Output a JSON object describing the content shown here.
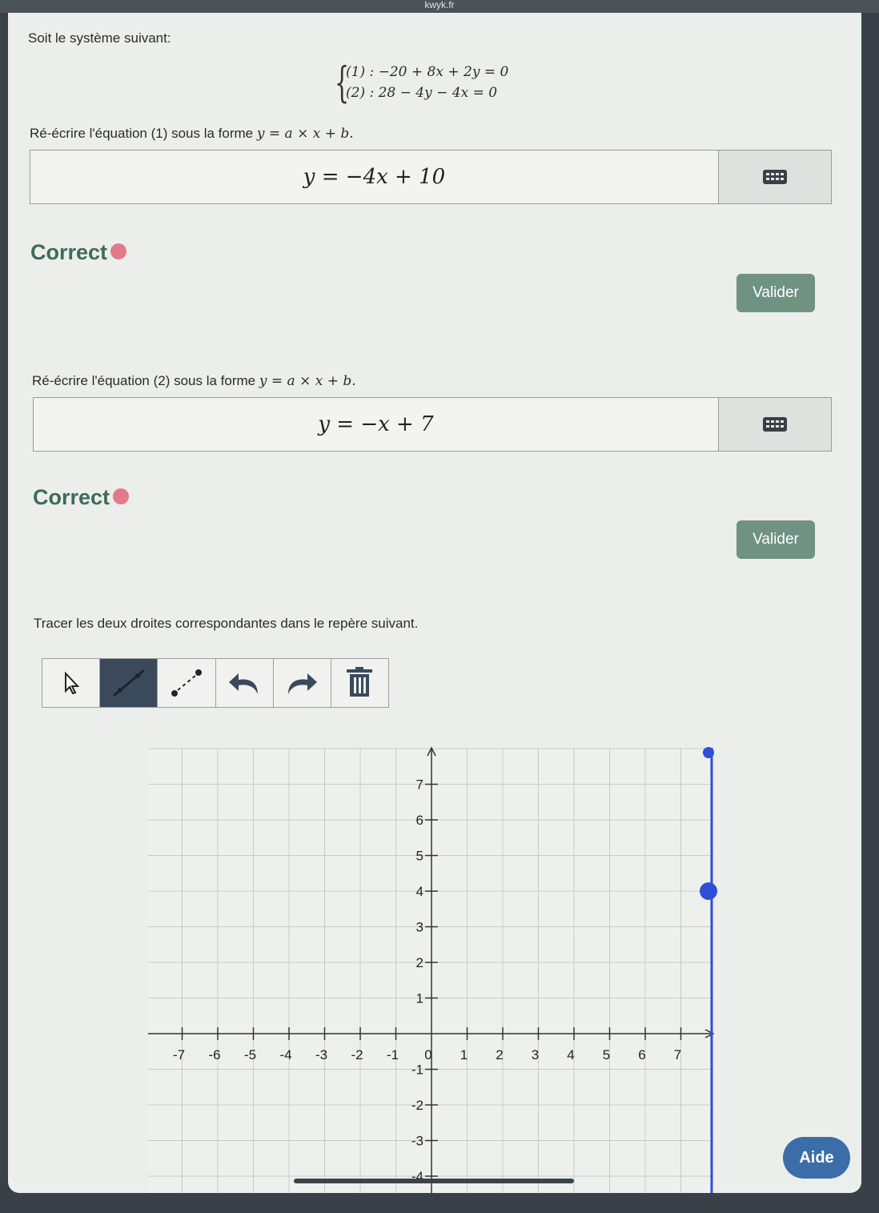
{
  "browser": {
    "url": "kwyk.fr"
  },
  "intro": "Soit le système suivant:",
  "system": {
    "line1": "(1) : −20 + 8x + 2y = 0",
    "line2": "(2) : 28 − 4y − 4x = 0"
  },
  "q1": {
    "prompt": "Ré-écrire l'équation (1) sous la forme",
    "form": "y = a × x + b.",
    "answer": "y = −4x + 10",
    "feedback": "Correct",
    "button": "Valider"
  },
  "q2": {
    "prompt": "Ré-écrire l'équation (2) sous la forme",
    "form": "y = a × x + b.",
    "answer": "y = −x + 7",
    "feedback": "Correct",
    "button": "Valider"
  },
  "q3": {
    "prompt": "Tracer les deux droites correspondantes dans le repère suivant."
  },
  "toolbar": {
    "tools": [
      "pointer-icon",
      "line-tool-icon",
      "dashed-line-tool-icon",
      "undo-icon",
      "redo-icon",
      "trash-icon"
    ],
    "active_tool": "line-tool-icon"
  },
  "graph": {
    "x_ticks": [
      "-7",
      "-6",
      "-5",
      "-4",
      "-3",
      "-2",
      "-1",
      "0",
      "1",
      "2",
      "3",
      "4",
      "5",
      "6",
      "7"
    ],
    "y_ticks": [
      "7",
      "6",
      "5",
      "4",
      "3",
      "2",
      "1",
      "-1",
      "-2",
      "-3",
      "-4"
    ],
    "colors": {
      "accent_line": "#2f4fd8",
      "grid": "#c9cbc9",
      "axis": "#333333"
    }
  },
  "help_button": "Aide",
  "colors": {
    "correct": "#3f6b58",
    "valider": "#6f9283",
    "aide": "#3b6ea8"
  }
}
